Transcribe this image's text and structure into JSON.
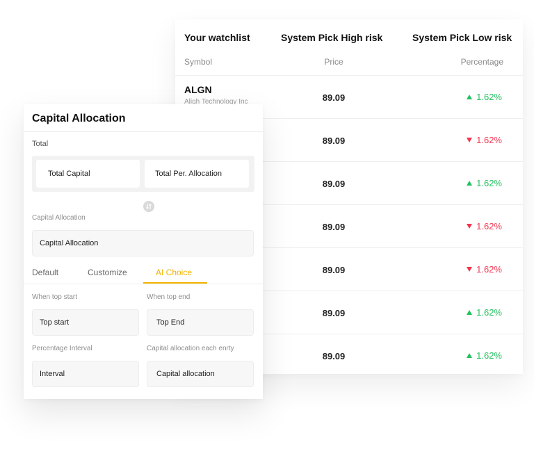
{
  "watchlist": {
    "tabs": [
      "Your watchlist",
      "System Pick High risk",
      "System Pick Low risk"
    ],
    "columns": {
      "symbol": "Symbol",
      "price": "Price",
      "percentage": "Percentage"
    },
    "rows": [
      {
        "symbol": "ALGN",
        "company": "Aligh Technology Inc",
        "price": "89.09",
        "change": "1.62%",
        "direction": "up"
      },
      {
        "symbol": "",
        "company": "",
        "price": "89.09",
        "change": "1.62%",
        "direction": "down"
      },
      {
        "symbol": "",
        "company": "",
        "price": "89.09",
        "change": "1.62%",
        "direction": "up"
      },
      {
        "symbol": "",
        "company": "",
        "price": "89.09",
        "change": "1.62%",
        "direction": "down"
      },
      {
        "symbol": "",
        "company": "",
        "price": "89.09",
        "change": "1.62%",
        "direction": "down"
      },
      {
        "symbol": "",
        "company": "",
        "price": "89.09",
        "change": "1.62%",
        "direction": "up"
      },
      {
        "symbol": "",
        "company": "",
        "price": "89.09",
        "change": "1.62%",
        "direction": "up"
      }
    ],
    "colors": {
      "up": "#21c15d",
      "down": "#f2354f"
    }
  },
  "allocation": {
    "title": "Capital Allocation",
    "total_label": "Total",
    "total_capital": "Total Capital",
    "total_per_allocation": "Total Per. Allocation",
    "capital_allocation_label": "Capital Allocation",
    "capital_allocation_value": "Capital Allocation",
    "choice_tabs": [
      "Default",
      "Customize",
      "AI Choice"
    ],
    "active_tab": "AI Choice",
    "accent_color": "#f0b300",
    "when_top_start_label": "When top start",
    "when_top_start_value": "Top start",
    "when_top_end_label": "When top end",
    "when_top_end_value": "Top End",
    "percentage_interval_label": "Percentage Interval",
    "percentage_interval_value": "Interval",
    "capital_each_entry_label": "Capital allocation each enrty",
    "capital_each_entry_value": "Capital allocation",
    "swap_icon": "swap-icon"
  }
}
